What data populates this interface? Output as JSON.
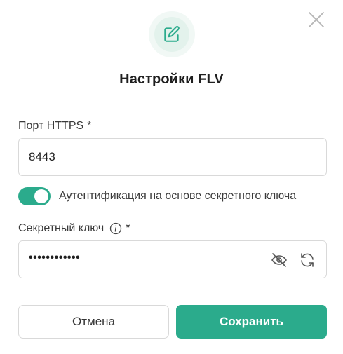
{
  "dialog": {
    "title": "Настройки FLV",
    "header_icon": "edit-icon",
    "close_icon": "close-icon"
  },
  "port_field": {
    "label": "Порт HTTPS",
    "required_mark": "*",
    "value": "8443"
  },
  "auth_toggle": {
    "label": "Аутентификация на основе секретного ключа",
    "enabled": true
  },
  "secret_key_field": {
    "label": "Секретный ключ",
    "info_icon": "info-icon",
    "required_mark": "*",
    "masked_value": "••••••••••••",
    "visibility_icon": "eye-off-icon",
    "regenerate_icon": "refresh-icon"
  },
  "buttons": {
    "cancel_label": "Отмена",
    "save_label": "Сохранить"
  },
  "colors": {
    "accent": "#2bab8c",
    "border": "#d9d9d9",
    "icon_bg": "#e3f2ec"
  }
}
